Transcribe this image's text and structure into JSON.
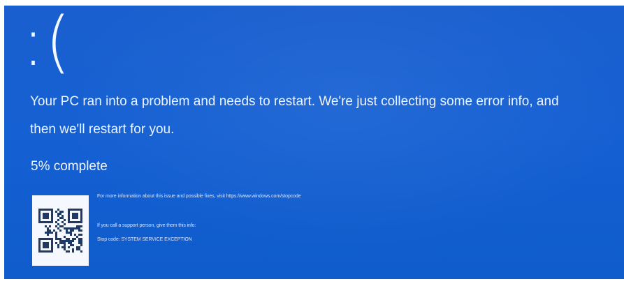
{
  "colors": {
    "background": "#1560d3",
    "text": "#eef4ff",
    "qr_background": "#f5f8ff"
  },
  "screen": {
    "emoticon": ":(",
    "message": "Your PC ran into a problem and needs to restart. We're just collecting some error info, and then we'll restart for you.",
    "progress_text": "5% complete",
    "progress_percent": 5,
    "qr_icon": "qr-code-icon",
    "info_text": "For more information about this issue and possible fixes, visit https://www.windows.com/stopcode",
    "support_text": "If you call a support person, give them this info:",
    "stop_code_text": "Stop code: SYSTEM SERVICE EXCEPTION"
  }
}
